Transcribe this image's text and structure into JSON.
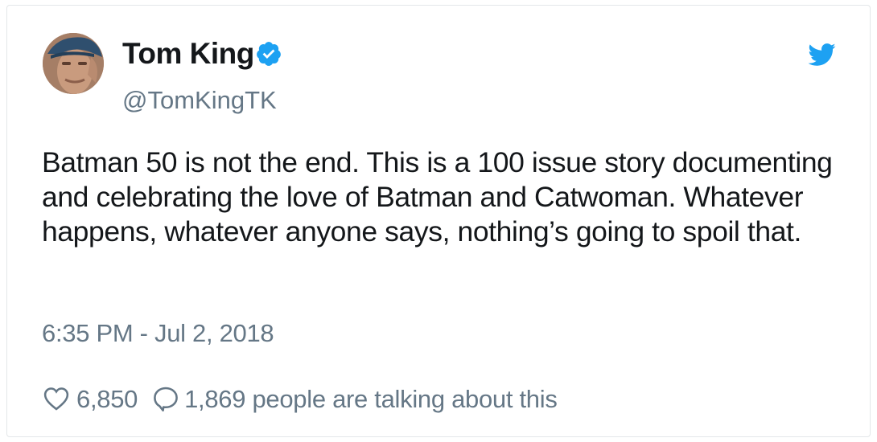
{
  "tweet": {
    "author": {
      "name": "Tom King",
      "handle": "@TomKingTK",
      "verified": true,
      "avatar_icon": "profile-photo"
    },
    "brand_icon": "twitter-bird-icon",
    "text_lines": [
      "Batman 50 is not the end. This is a 100 issue story documenting",
      "and celebrating the love of Batman and Catwoman. Whatever",
      "happens, whatever anyone says, nothing’s going to spoil that."
    ],
    "timestamp": "6:35 PM - Jul 2, 2018",
    "likes": "6,850",
    "replies_text": "1,869 people are talking about this"
  },
  "colors": {
    "twitter_blue": "#1da1f2",
    "text_primary": "#14171a",
    "text_secondary": "#657786",
    "border": "#e3e6e9"
  }
}
